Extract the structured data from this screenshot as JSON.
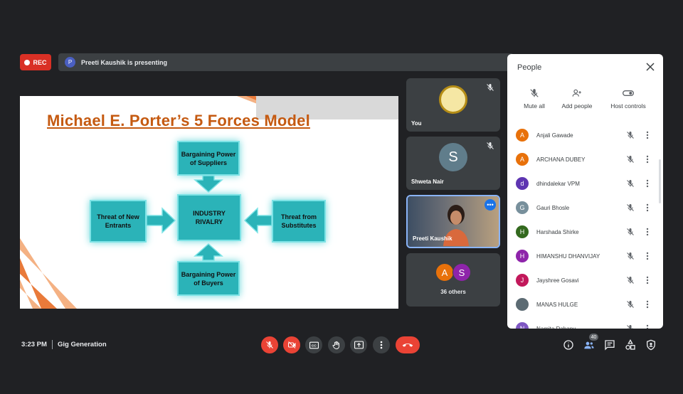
{
  "top": {
    "rec_label": "REC",
    "presenter_initial": "P",
    "presenting_text": "Preeti Kaushik is presenting"
  },
  "slide": {
    "title": "Michael E. Porter’s 5 Forces Model",
    "suppliers": "Bargaining Power of Suppliers",
    "buyers": "Bargaining Power of Buyers",
    "rivalry": "INDUSTRY RIVALRY",
    "new_entrants": "Threat of New Entrants",
    "substitutes": "Threat from Substitutes"
  },
  "tiles": {
    "you": "You",
    "shweta_initial": "S",
    "shweta": "Shweta Nair",
    "preeti": "Preeti Kaushik",
    "others_a": "A",
    "others_s": "S",
    "others_label": "36 others",
    "more_glyph": "•••"
  },
  "people": {
    "title": "People",
    "mute_all": "Mute all",
    "add_people": "Add people",
    "host_controls": "Host controls",
    "list": [
      {
        "initial": "A",
        "name": "Anjali Gawade",
        "color": "#e8710a"
      },
      {
        "initial": "A",
        "name": "ARCHANA DUBEY",
        "color": "#e8710a"
      },
      {
        "initial": "d",
        "name": "dhindalekar VPM",
        "color": "#5e35b1"
      },
      {
        "initial": "G",
        "name": "Gauri Bhosle",
        "color": "#78909c"
      },
      {
        "initial": "H",
        "name": "Harshada Shirke",
        "color": "#33691e"
      },
      {
        "initial": "H",
        "name": "HIMANSHU DHANVIJAY",
        "color": "#8e24aa"
      },
      {
        "initial": "J",
        "name": "Jayshree Gosavi",
        "color": "#c2185b"
      },
      {
        "initial": "",
        "name": "MANAS HULGE",
        "color": "#5c6b73"
      },
      {
        "initial": "N",
        "name": "Namita Dahanu",
        "color": "#7e57c2"
      }
    ]
  },
  "bottom": {
    "time": "3:23 PM",
    "meeting": "Gig Generation",
    "participant_count": "40"
  }
}
